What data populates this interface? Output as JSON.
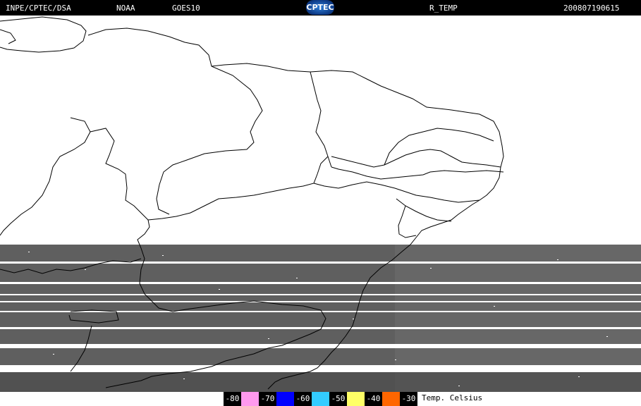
{
  "header": {
    "org": "INPE/CPTEC/DSA",
    "agency": "NOAA",
    "satellite": "GOES10",
    "logo_text": "CPTEC",
    "product": "R_TEMP",
    "timestamp": "200807190615"
  },
  "legend": {
    "label": "Temp. Celsius",
    "steps": [
      {
        "value": "-80",
        "color": "#ff99ee"
      },
      {
        "value": "-70",
        "color": "#0000ff"
      },
      {
        "value": "-60",
        "color": "#33ccff"
      },
      {
        "value": "-50",
        "color": "#ffff66"
      },
      {
        "value": "-40",
        "color": "#ff6600"
      },
      {
        "value": "-30",
        "color": ""
      }
    ]
  },
  "colors": {
    "background": "#ffffff",
    "imagery": "#5e5e5e",
    "coastline": "#000000"
  }
}
